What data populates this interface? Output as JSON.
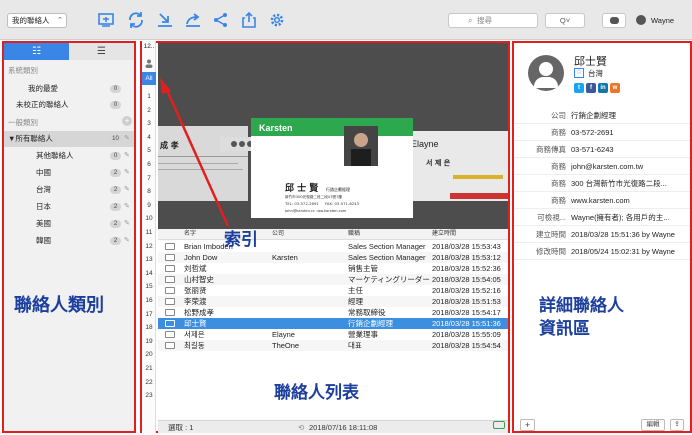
{
  "toolbar": {
    "group_select": "我的聯絡人",
    "search_placeholder": "搜尋",
    "search_option": "Q˅",
    "username": "Wayne"
  },
  "colors": {
    "accent": "#3a86e6",
    "annotation": "#1c3f9e",
    "highlight_border": "#e02020",
    "selection": "#3b8ee0"
  },
  "sidebar": {
    "tab_a": "☷",
    "tab_b": "☰",
    "system_header": "系統類別",
    "favorites": "我的最愛",
    "favorites_count": "0",
    "unverified": "未校正的聯絡人",
    "unverified_count": "0",
    "general_header": "一般類別",
    "all_contacts": "▼所有聯絡人",
    "all_count": "10",
    "groups": [
      {
        "label": "其他聯絡人",
        "count": "0"
      },
      {
        "label": "中國",
        "count": "2"
      },
      {
        "label": "台灣",
        "count": "2"
      },
      {
        "label": "日本",
        "count": "2"
      },
      {
        "label": "美國",
        "count": "2"
      },
      {
        "label": "韓國",
        "count": "2"
      }
    ],
    "annotation": "聯絡人類別"
  },
  "index": {
    "header": "12..",
    "all": "All",
    "numbers": [
      "1",
      "2",
      "3",
      "4",
      "5",
      "6",
      "7",
      "8",
      "9",
      "10",
      "11",
      "12",
      "13",
      "14",
      "15",
      "16",
      "17",
      "18",
      "19",
      "20",
      "21",
      "22",
      "23"
    ],
    "annotation": "索引"
  },
  "list": {
    "columns": {
      "name": "名字",
      "company": "公司",
      "title": "職稱",
      "created": "建立時間"
    },
    "rows": [
      {
        "name": "Brian Imboden",
        "company": "",
        "title": "Sales Section Manager",
        "created": "2018/03/28 15:53:43"
      },
      {
        "name": "John Dow",
        "company": "Karsten",
        "title": "Sales Section Manager",
        "created": "2018/03/28 15:53:12"
      },
      {
        "name": "刘哲斌",
        "company": "",
        "title": "销售主管",
        "created": "2018/03/28 15:52:36"
      },
      {
        "name": "山村智史",
        "company": "",
        "title": "マーケティングリーダー",
        "created": "2018/03/28 15:54:05"
      },
      {
        "name": "张丽贤",
        "company": "",
        "title": "主任",
        "created": "2018/03/28 15:52:16"
      },
      {
        "name": "李荣渡",
        "company": "",
        "title": "經理",
        "created": "2018/03/28 15:51:53"
      },
      {
        "name": "松野成孝",
        "company": "",
        "title": "常務取締役",
        "created": "2018/03/28 15:54:17"
      },
      {
        "name": "邱士賢",
        "company": "",
        "title": "行銷企劃經理",
        "created": "2018/03/28 15:51:36"
      },
      {
        "name": "서제은",
        "company": "Elayne",
        "title": "營業理事",
        "created": "2018/03/28 15:55:09"
      },
      {
        "name": "최길동",
        "company": "TheOne",
        "title": "대표",
        "created": "2018/03/28 15:54:54"
      }
    ],
    "selected_index": 7,
    "annotation": "聯絡人列表"
  },
  "cards": {
    "main_company": "Karsten",
    "main_name": "邱 士 賢",
    "main_title": "行銷企劃經理",
    "main_address": "新竹市300光復路二段二段47號7樓",
    "main_tel": "TEL: 03-572-2691",
    "main_fax": "FAX: 03-571-6243",
    "main_email": "John@karsten.cc  :ww.karsten.com",
    "right_company": "Elayne",
    "right_name": "서 제 은",
    "left_name": "成 孝"
  },
  "status": {
    "selected": "選取 : 1",
    "sync": "2018/07/16 18:11:08"
  },
  "details": {
    "name": "邱士賢",
    "country": "台灣",
    "rows": [
      {
        "key": "公司",
        "value": "行銷企劃經理"
      },
      {
        "key": "商務",
        "value": "03-572-2691"
      },
      {
        "key": "商務傳真",
        "value": "03-571-6243"
      },
      {
        "key": "商務",
        "value": "john@karsten.com.tw"
      },
      {
        "key": "商務",
        "value": "300 台灣新竹市光復路二段..."
      },
      {
        "key": "商務",
        "value": "www.karsten.com"
      },
      {
        "key": "可檢視...",
        "value": "Wayne(擁有者); 各用戶的主..."
      },
      {
        "key": "建立時間",
        "value": "2018/03/28 15:51:36 by Wayne"
      },
      {
        "key": "修改時間",
        "value": "2018/05/24 15:02:31 by Wayne"
      }
    ],
    "annotation_line1": "詳細聯絡人",
    "annotation_line2": "資訊區",
    "add": "+",
    "edit": "編輯"
  }
}
